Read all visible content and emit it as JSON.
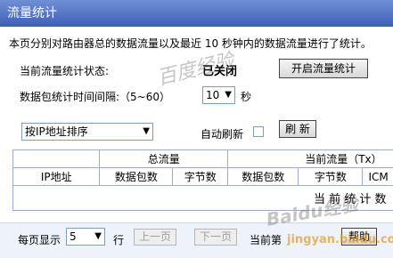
{
  "window": {
    "title": "流量统计"
  },
  "description": "本页分别对路由器总的数据流量以及最近 10 秒钟内的数据流量进行了统计。",
  "status": {
    "label": "当前流量统计状态:",
    "value": "已关闭",
    "toggle_button": "开启流量统计"
  },
  "interval": {
    "label": "数据包统计时间间隔:（5~60）",
    "value": "10",
    "unit": "秒"
  },
  "sort": {
    "value": "按IP地址排序"
  },
  "auto_refresh": {
    "label": "自动刷新",
    "checked": false,
    "refresh_button": "刷 新"
  },
  "table": {
    "group_headers": [
      "总流量",
      "当前流量（Tx）"
    ],
    "columns": [
      "IP地址",
      "数据包数",
      "字节数",
      "数据包数",
      "字节数",
      "ICM"
    ],
    "empty_text": "当 前 统 计 数"
  },
  "footer": {
    "per_page_label": "每页显示",
    "per_page_value": "5",
    "rows_unit": "行",
    "prev_button": "上一页",
    "next_button": "下一页",
    "current_label": "当前第",
    "help_button": "帮助"
  },
  "watermarks": [
    "百度经验",
    "Baidu经验",
    "jingyan.baidu.com"
  ],
  "colors": {
    "titlebar": "#4f6fc6",
    "status_value": "#000000",
    "table_border": "#9aaecb"
  }
}
